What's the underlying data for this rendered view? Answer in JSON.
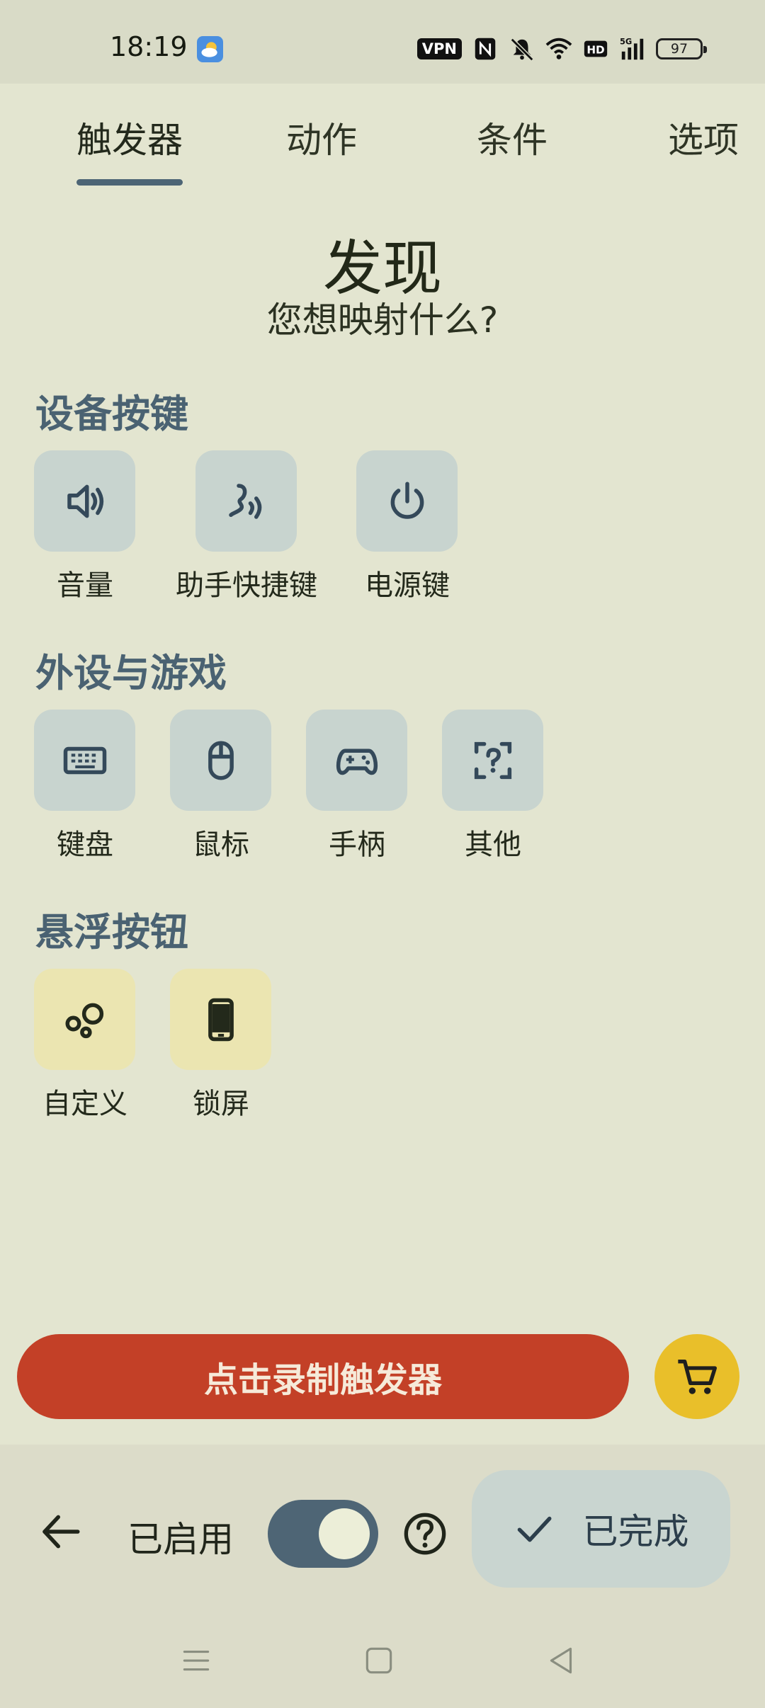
{
  "status_bar": {
    "time": "18:19",
    "vpn_label": "VPN",
    "battery_level": "97",
    "icons": [
      "weather-icon",
      "nfc-icon",
      "mute-icon",
      "wifi-icon",
      "hd-icon",
      "signal-5g-icon",
      "battery-icon"
    ]
  },
  "tabs": [
    {
      "label": "触发器",
      "active": true
    },
    {
      "label": "动作",
      "active": false
    },
    {
      "label": "条件",
      "active": false
    },
    {
      "label": "选项",
      "active": false
    }
  ],
  "header": {
    "title": "发现",
    "subtitle": "您想映射什么?"
  },
  "sections": [
    {
      "title": "设备按键",
      "items": [
        {
          "label": "音量",
          "icon": "volume-icon"
        },
        {
          "label": "助手快捷键",
          "icon": "assistant-icon"
        },
        {
          "label": "电源键",
          "icon": "power-icon"
        }
      ]
    },
    {
      "title": "外设与游戏",
      "items": [
        {
          "label": "键盘",
          "icon": "keyboard-icon"
        },
        {
          "label": "鼠标",
          "icon": "mouse-icon"
        },
        {
          "label": "手柄",
          "icon": "gamepad-icon"
        },
        {
          "label": "其他",
          "icon": "unknown-device-icon"
        }
      ]
    },
    {
      "title": "悬浮按钮",
      "items": [
        {
          "label": "自定义",
          "icon": "bubbles-icon"
        },
        {
          "label": "锁屏",
          "icon": "phone-icon"
        }
      ]
    }
  ],
  "record_button": {
    "label": "点击录制触发器"
  },
  "bottom_bar": {
    "enabled_label": "已启用",
    "toggle_on": true,
    "done_label": "已完成"
  },
  "colors": {
    "background": "#e3e5d0",
    "accent": "#4e6575",
    "record": "#c34027",
    "cart": "#e9bf2a"
  }
}
